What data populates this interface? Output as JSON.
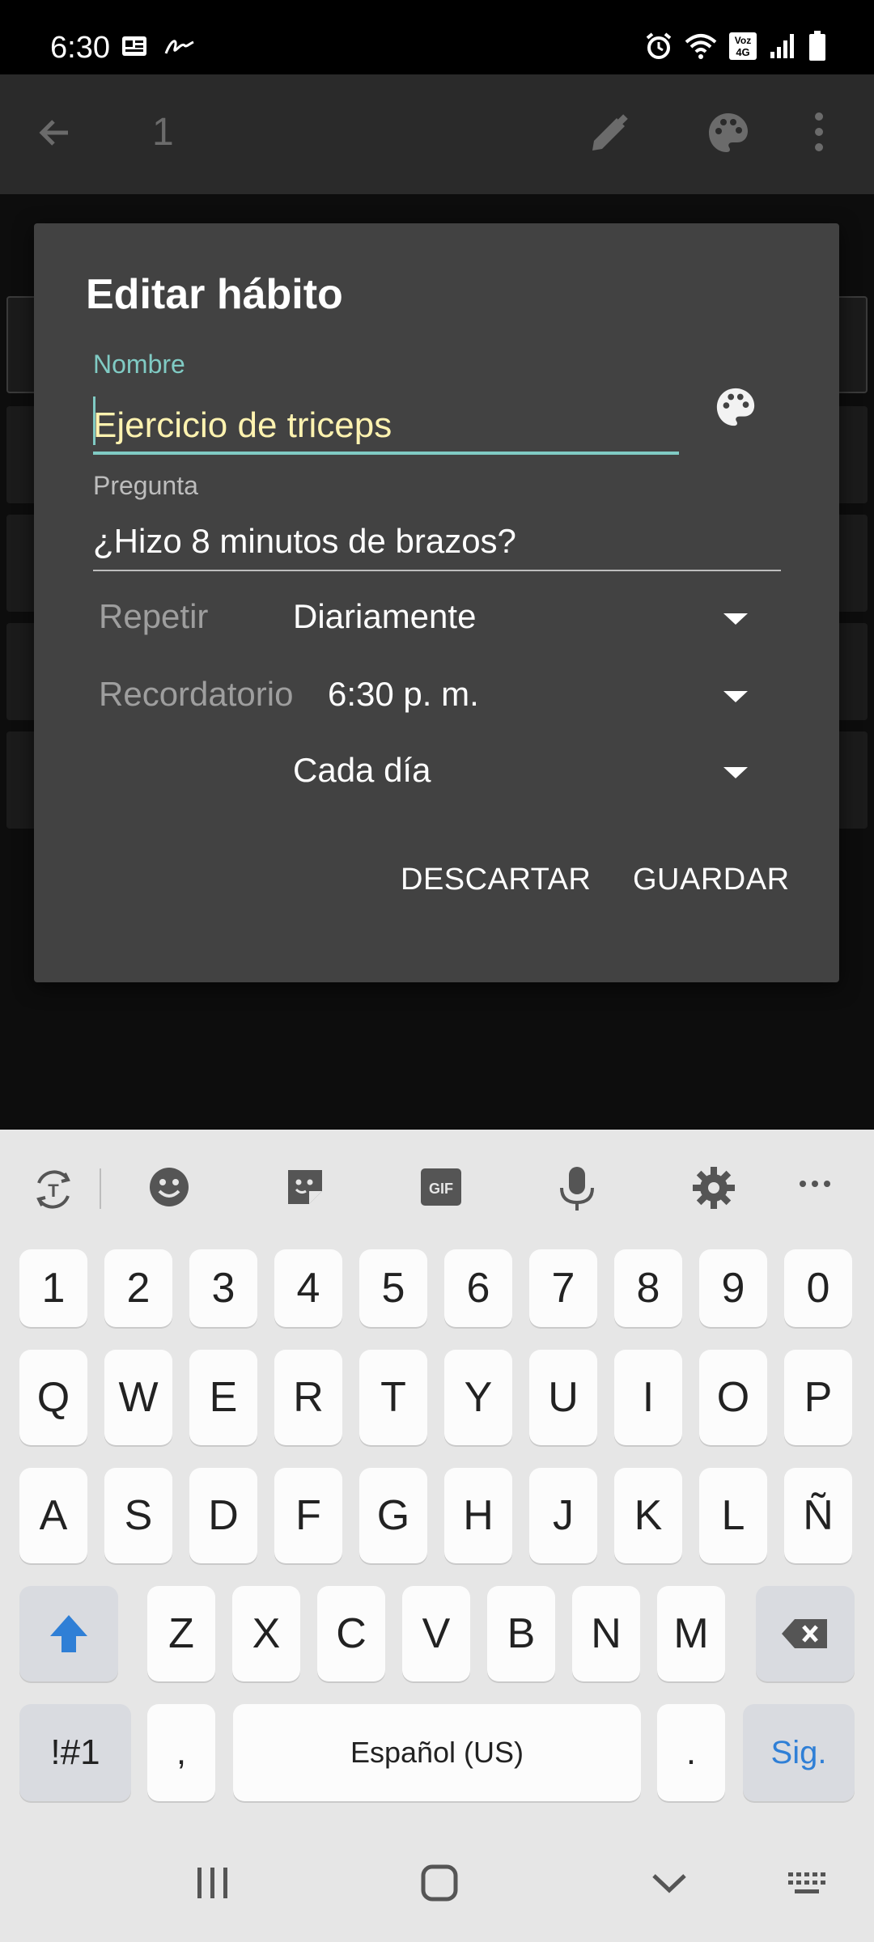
{
  "status_bar": {
    "time": "6:30",
    "icons": [
      "sim-notification-icon",
      "signature-icon",
      "alarm-icon",
      "wifi-icon",
      "volte-icon",
      "signal-icon",
      "battery-icon"
    ],
    "volte_text": "Voz\n4G"
  },
  "app_bar": {
    "title": "1",
    "icons": [
      "back-arrow-icon",
      "edit-pencil-icon",
      "palette-icon",
      "more-vertical-icon"
    ]
  },
  "dialog": {
    "title": "Editar hábito",
    "name_label": "Nombre",
    "name_value": "Ejercicio de triceps",
    "question_label": "Pregunta",
    "question_value": "¿Hizo 8 minutos de brazos?",
    "repeat_label": "Repetir",
    "repeat_value": "Diariamente",
    "reminder_label": "Recordatorio",
    "reminder_value": "6:30 p. m.",
    "reminder_days_value": "Cada día",
    "discard_label": "DESCARTAR",
    "save_label": "GUARDAR",
    "accent_color": "#80cbc4"
  },
  "keyboard": {
    "number_row": [
      "1",
      "2",
      "3",
      "4",
      "5",
      "6",
      "7",
      "8",
      "9",
      "0"
    ],
    "row1": [
      "Q",
      "W",
      "E",
      "R",
      "T",
      "Y",
      "U",
      "I",
      "O",
      "P"
    ],
    "row2": [
      "A",
      "S",
      "D",
      "F",
      "G",
      "H",
      "J",
      "K",
      "L",
      "Ñ"
    ],
    "row3": [
      "Z",
      "X",
      "C",
      "V",
      "B",
      "N",
      "M"
    ],
    "symbols_label": "!#1",
    "comma_label": ",",
    "space_label": "Español (US)",
    "period_label": ".",
    "next_label": "Sig.",
    "gif_label": "GIF",
    "action_color": "#2f7fd6"
  }
}
